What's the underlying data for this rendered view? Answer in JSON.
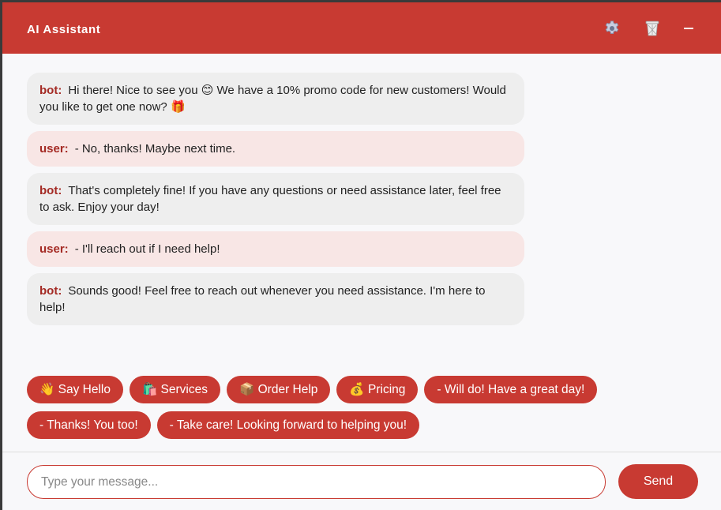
{
  "header": {
    "title": "AI Assistant",
    "settings_icon": "gear-icon",
    "clear_icon": "trash-icon",
    "minimize_icon": "minimize-icon"
  },
  "messages": [
    {
      "sender": "bot:",
      "text": "Hi there! Nice to see you 😊 We have a 10% promo code for new customers! Would you like to get one now? 🎁"
    },
    {
      "sender": "user:",
      "text": "- No, thanks! Maybe next time."
    },
    {
      "sender": "bot:",
      "text": "That's completely fine! If you have any questions or need assistance later, feel free to ask. Enjoy your day!"
    },
    {
      "sender": "user:",
      "text": "- I'll reach out if I need help!"
    },
    {
      "sender": "bot:",
      "text": "Sounds good! Feel free to reach out whenever you need assistance. I'm here to help!"
    }
  ],
  "quick_replies": [
    "👋 Say Hello",
    "🛍️ Services",
    "📦 Order Help",
    "💰 Pricing",
    "- Will do! Have a great day!",
    "- Thanks! You too!",
    "- Take care! Looking forward to helping you!"
  ],
  "composer": {
    "placeholder": "Type your message...",
    "value": "",
    "send_label": "Send"
  },
  "colors": {
    "accent": "#c83a32",
    "bot_bubble": "#eeeeee",
    "user_bubble": "#f8e6e5",
    "sender_label": "#a42a24"
  }
}
